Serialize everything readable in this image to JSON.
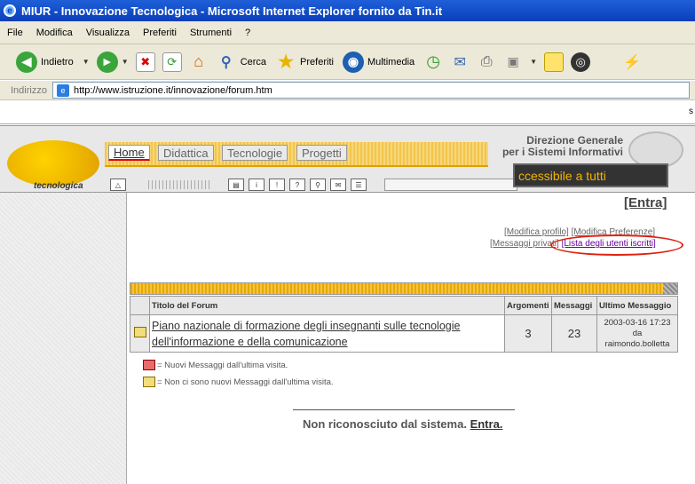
{
  "window": {
    "title": "MIUR - Innovazione Tecnologica - Microsoft Internet Explorer fornito da Tin.it"
  },
  "menu": [
    "File",
    "Modifica",
    "Visualizza",
    "Preferiti",
    "Strumenti",
    "?"
  ],
  "toolbar": {
    "back": "Indietro",
    "search": "Cerca",
    "favorites": "Preferiti",
    "media": "Multimedia"
  },
  "address": {
    "label": "Indirizzo",
    "url": "http://www.istruzione.it/innovazione/forum.htm"
  },
  "linksbar": {
    "edge_text": "s"
  },
  "site": {
    "logo_text": "tecnologica",
    "tabs": [
      "Home",
      "Didattica",
      "Tecnologie",
      "Progetti"
    ],
    "direzione": "Direzione Generale",
    "sistemi": "per i Sistemi Informativi",
    "accessible": "ccessibile a tutti"
  },
  "page": {
    "entra_top": "[Entra]",
    "modifica_profilo": "[Modifica profilo]",
    "modifica_preferenze": "[Modifica Preferenze]",
    "messaggi_privati": "[Messaggi privati]",
    "lista_utenti": "[Lista degli utenti iscritti]"
  },
  "forum_table": {
    "headers": [
      "Titolo del Forum",
      "Argomenti",
      "Messaggi",
      "Ultimo Messaggio"
    ],
    "rows": [
      {
        "title": "Piano nazionale di formazione degli insegnanti sulle tecnologie dell'informazione e della comunicazione",
        "argomenti": "3",
        "messaggi": "23",
        "last_date": "2003-03-16 17:23",
        "last_by": "da",
        "last_user": "raimondo.bolletta"
      }
    ]
  },
  "legend": {
    "new": "= Nuovi Messaggi dall'ultima visita.",
    "none": "= Non ci sono nuovi Messaggi dall'ultima visita."
  },
  "footer": {
    "text": "Non riconosciuto dal sistema.",
    "link": "Entra."
  },
  "colors": {
    "titlebar": "#0a3fb9",
    "accent": "#f4b400",
    "highlight": "#d21111"
  }
}
